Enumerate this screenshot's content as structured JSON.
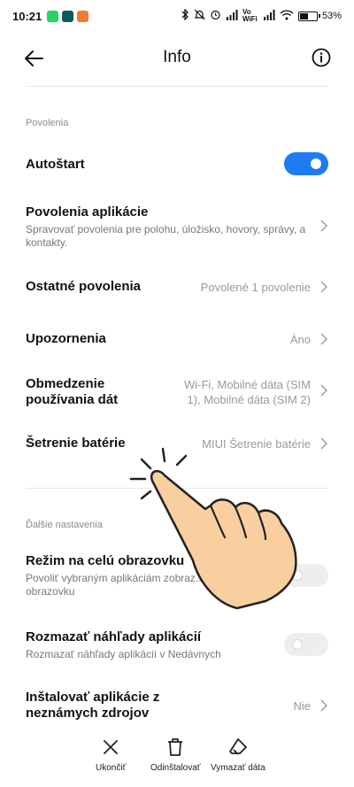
{
  "status_bar": {
    "time": "10:21",
    "network_text": "Vo WiFi",
    "battery_percent": "53%",
    "battery_level": 0.53,
    "notification_icons": [
      "whatsapp-icon",
      "app-icon",
      "app-icon"
    ],
    "status_icons": [
      "bluetooth-icon",
      "mute-icon",
      "alarm-icon",
      "signal-icon",
      "wifi-icon",
      "battery-icon"
    ]
  },
  "header": {
    "title": "Info",
    "back_icon": "arrow-left-icon",
    "info_icon": "info-circle-icon"
  },
  "sections": [
    {
      "label": "Povolenia",
      "rows": [
        {
          "title": "Autoštart",
          "toggle": true
        },
        {
          "title": "Povolenia aplikácie",
          "subtitle": "Spravovať povolenia pre polohu, úložisko, hovory, správy, a kontakty."
        },
        {
          "title": "Ostatné povolenia",
          "value": "Povolené 1 povolenie"
        },
        {
          "title": "Upozornenia",
          "value": "Áno"
        },
        {
          "title": "Obmedzenie používania dát",
          "value": "Wi-Fi, Mobilné dáta (SIM 1), Mobilné dáta (SIM 2)"
        },
        {
          "title": "Šetrenie batérie",
          "value": "MIUI Šetrenie batérie"
        }
      ]
    },
    {
      "label": "Ďalšie nastavenia",
      "rows": [
        {
          "title": "Režim na celú obrazovku",
          "subtitle": "Povoliť vybraným aplikáciám zobraz... obrazovku",
          "toggle": false
        },
        {
          "title": "Rozmazať náhľady aplikácií",
          "subtitle": "Rozmazať náhľady aplikácií v Nedávnych",
          "toggle": false
        },
        {
          "title": "Inštalovať aplikácie z neznámych zdrojov",
          "value": "Nie"
        }
      ]
    }
  ],
  "bottom_bar": [
    {
      "label": "Ukončiť",
      "icon": "close-icon"
    },
    {
      "label": "Odinštalovať",
      "icon": "trash-icon"
    },
    {
      "label": "Vymazať dáta",
      "icon": "eraser-icon"
    }
  ],
  "colors": {
    "accent": "#1e7cf2",
    "hand_fill": "#f9cfa0",
    "hand_outline": "#222222"
  }
}
